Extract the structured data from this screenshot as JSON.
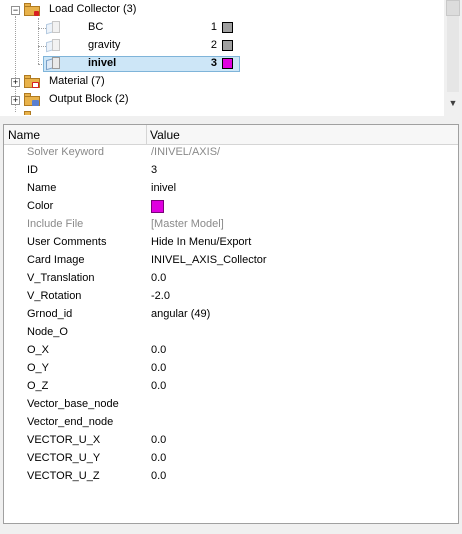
{
  "tree": {
    "items": [
      {
        "label": "Load Collector (3)",
        "expanded": true,
        "icon": "load-collector-folder-icon"
      },
      {
        "label": "BC",
        "id": "1",
        "color": "#a0a0a0"
      },
      {
        "label": "gravity",
        "id": "2",
        "color": "#a0a0a0"
      },
      {
        "label": "inivel",
        "id": "3",
        "color": "#e000e0",
        "selected": true
      },
      {
        "label": "Material (7)",
        "expanded": false,
        "icon": "material-folder-icon"
      },
      {
        "label": "Output Block (2)",
        "expanded": false,
        "icon": "output-block-folder-icon"
      }
    ]
  },
  "table": {
    "col_name": "Name",
    "col_value": "Value",
    "rows": [
      {
        "name": "Solver Keyword",
        "value": "/INIVEL/AXIS/",
        "disabled": true
      },
      {
        "name": "ID",
        "value": "3"
      },
      {
        "name": "Name",
        "value": "inivel"
      },
      {
        "name": "Color",
        "value": "",
        "swatch": "#e000e0"
      },
      {
        "name": "Include File",
        "value": "[Master Model]",
        "disabled": true
      },
      {
        "name": "User Comments",
        "value": "Hide In Menu/Export"
      },
      {
        "name": "Card Image",
        "value": "INIVEL_AXIS_Collector"
      },
      {
        "name": "V_Translation",
        "value": "0.0"
      },
      {
        "name": "V_Rotation",
        "value": "-2.0"
      },
      {
        "name": "Grnod_id",
        "value": "angular (49)"
      },
      {
        "name": "Node_O",
        "value": ""
      },
      {
        "name": "O_X",
        "value": "0.0"
      },
      {
        "name": "O_Y",
        "value": "0.0"
      },
      {
        "name": "O_Z",
        "value": "0.0"
      },
      {
        "name": "Vector_base_node",
        "value": ""
      },
      {
        "name": "Vector_end_node",
        "value": ""
      },
      {
        "name": "VECTOR_U_X",
        "value": "0.0"
      },
      {
        "name": "VECTOR_U_Y",
        "value": "0.0"
      },
      {
        "name": "VECTOR_U_Z",
        "value": "0.0"
      }
    ]
  },
  "colors": {
    "selection_bg": "#cde6f7",
    "inivel_color": "#e000e0",
    "gray_swatch": "#a0a0a0"
  }
}
